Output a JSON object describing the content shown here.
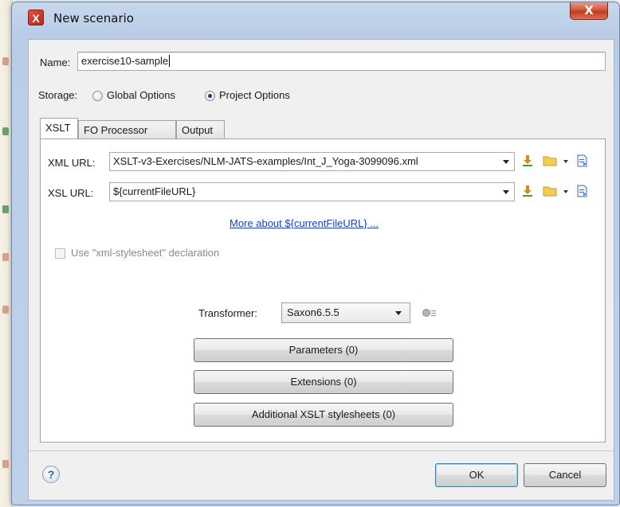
{
  "window": {
    "title": "New scenario",
    "close_glyph": "X"
  },
  "name_field": {
    "label": "Name:",
    "value": "exercise10-sample"
  },
  "storage": {
    "label": "Storage:",
    "options": [
      {
        "label": "Global Options",
        "selected": false
      },
      {
        "label": "Project Options",
        "selected": true
      }
    ]
  },
  "tabs": [
    {
      "label": "XSLT",
      "active": true
    },
    {
      "label": "FO Processor",
      "active": false
    },
    {
      "label": "Output",
      "active": false
    }
  ],
  "xslt": {
    "xml_url_label": "XML URL:",
    "xml_url_value": "XSLT-v3-Exercises/NLM-JATS-examples/Int_J_Yoga-3099096.xml",
    "xsl_url_label": "XSL URL:",
    "xsl_url_value": "${currentFileURL}",
    "more_link": "More about ${currentFileURL} ...",
    "use_stylesheet_label": "Use \"xml-stylesheet\" declaration",
    "transformer_label": "Transformer:",
    "transformer_value": "Saxon6.5.5",
    "buttons": {
      "parameters": "Parameters (0)",
      "extensions": "Extensions (0)",
      "additional": "Additional XSLT stylesheets (0)"
    }
  },
  "footer": {
    "help_glyph": "?",
    "ok": "OK",
    "cancel": "Cancel"
  },
  "colors": {
    "link": "#1a3fc6",
    "title_bar": "#bfd1e8",
    "close": "#c23a1f"
  }
}
